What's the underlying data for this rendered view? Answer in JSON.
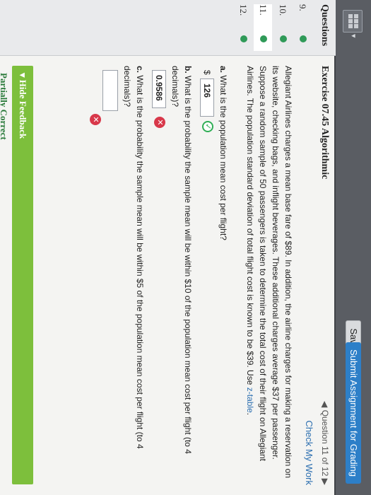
{
  "toolbar": {
    "grid_icon": "grid-icon",
    "save_label": "Save",
    "submit_label": "Submit Assignment for Grading"
  },
  "sidebar": {
    "title": "Questions",
    "items": [
      {
        "num": "9.",
        "status": "answered"
      },
      {
        "num": "10.",
        "status": "answered"
      },
      {
        "num": "11.",
        "status": "answered"
      },
      {
        "num": "12.",
        "status": "answered"
      }
    ]
  },
  "main": {
    "nav": "◀ Question 11 of 12 ▶",
    "exercise_title": "Exercise 07.45 Algorithmic",
    "check_work": "Check My Work",
    "paragraph": "Allegiant Airlines charges a mean base fare of $89. In addition, the airline charges for making a reservation on its website, checking bags, and inflight beverages. These additional charges average $37 per passenger. Suppose a random sample of 50 passengers is taken to determine the total cost of their flight on Allegiant Airlines. The population standard deviation of total flight cost is known to be $39. Use",
    "paragraph_link": "z-table",
    "parts": {
      "a_question": "What is the population mean cost per flight?",
      "a_prefix": "$",
      "a_answer": "126",
      "b_question": "What is the probability the sample mean will be within $10 of the population mean cost per flight (to 4 decimals)?",
      "b_answer": "0.9586",
      "c_question": "What is the probability the sample mean will be within $5 of the population mean cost per flight (to 4 decimals)?",
      "c_answer": ""
    },
    "feedback_label": "Hide Feedback",
    "feedback_sub": "Partially Correct"
  },
  "colors": {
    "accent_blue": "#2d7fc8",
    "success_green": "#2fae55",
    "error_red": "#d8384a",
    "feedback_green": "#7dbf3c"
  }
}
